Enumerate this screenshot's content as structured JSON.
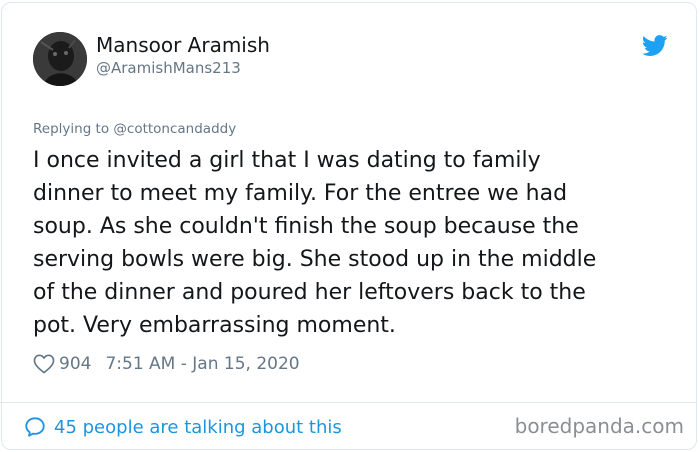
{
  "user": {
    "name": "Mansoor Aramish",
    "handle": "@AramishMans213"
  },
  "tweet": {
    "reply_prefix": "Replying to",
    "reply_to": "@cottoncandaddy",
    "lines": [
      "I once invited a girl that I was dating to family",
      "dinner to meet my family. For the entree we had",
      "soup. As she couldn't finish the soup because the",
      "serving bowls were big. She stood up in the middle",
      "of the dinner and poured her leftovers back to the",
      "pot. Very embarrassing moment."
    ],
    "likes": "904",
    "timestamp": "7:51 AM - Jan 15, 2020"
  },
  "footer": {
    "talking": "45 people are talking about this",
    "watermark": "boredpanda.com"
  },
  "icons": {
    "bird": "twitter-bird-icon",
    "heart": "heart-outline-icon",
    "bubble": "speech-bubble-icon"
  },
  "colors": {
    "twitter_blue": "#1da1f2",
    "link_blue": "#1b95e0",
    "secondary_text": "#657786",
    "primary_text": "#14171a",
    "border": "#e1e8ed"
  }
}
